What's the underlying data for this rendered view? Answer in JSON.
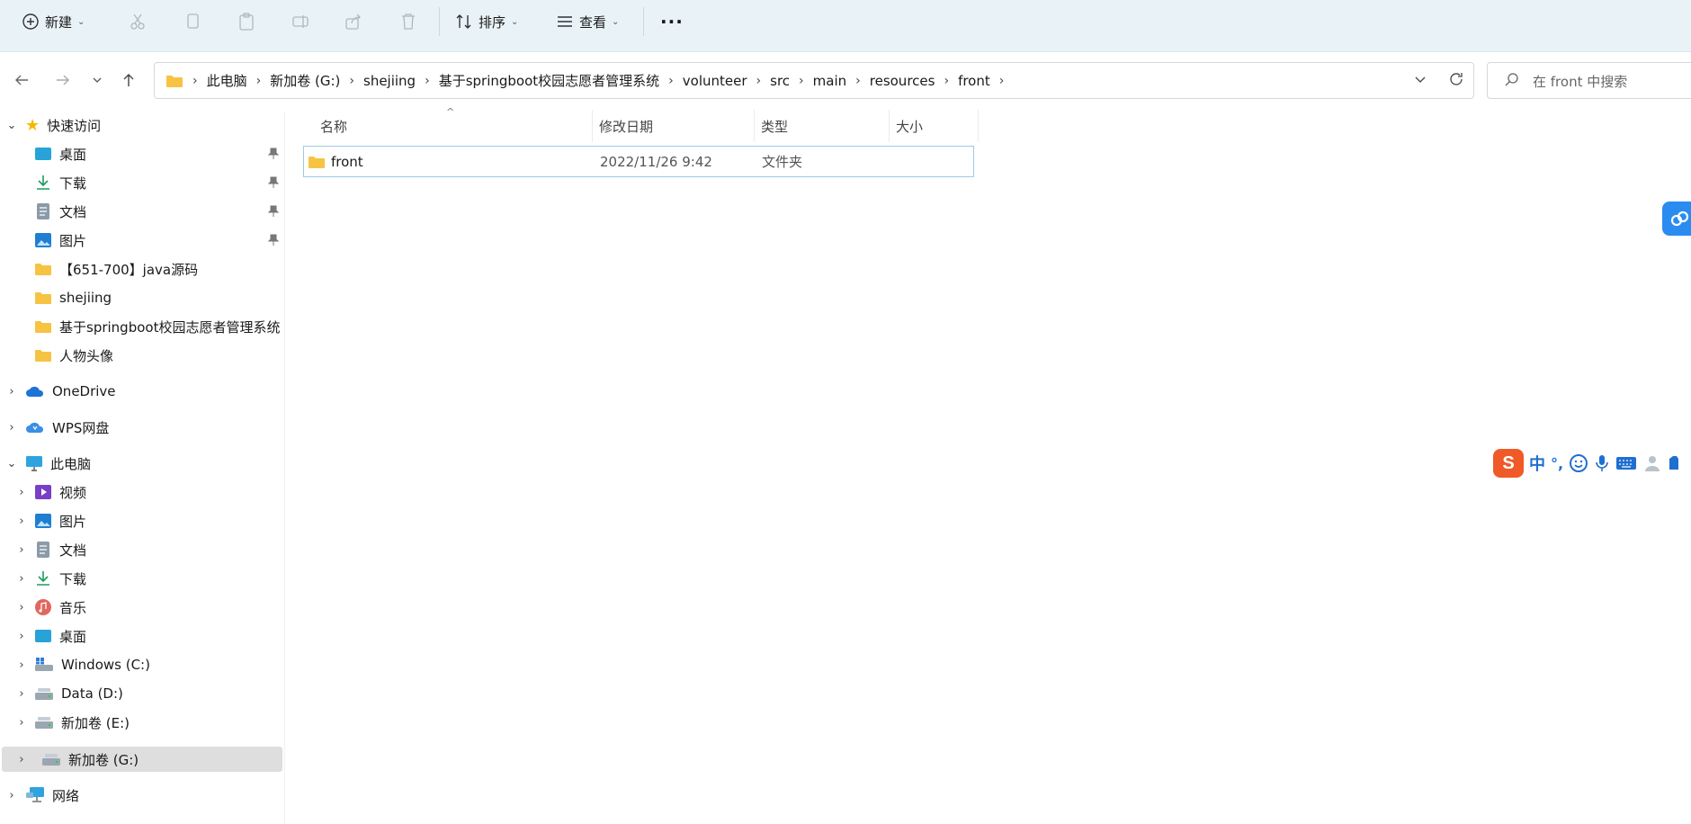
{
  "toolbar": {
    "new_label": "新建",
    "sort_label": "排序",
    "view_label": "查看",
    "more_label": "···"
  },
  "address": {
    "crumbs": [
      "此电脑",
      "新加卷 (G:)",
      "shejiing",
      "基于springboot校园志愿者管理系统",
      "volunteer",
      "src",
      "main",
      "resources",
      "front"
    ]
  },
  "search": {
    "placeholder": "在 front 中搜索"
  },
  "sidebar": {
    "quick_access": "快速访问",
    "quick_items": [
      "桌面",
      "下载",
      "文档",
      "图片",
      "【651-700】java源码",
      "shejiing",
      "基于springboot校园志愿者管理系统",
      "人物头像"
    ],
    "onedrive": "OneDrive",
    "wps": "WPS网盘",
    "this_pc": "此电脑",
    "pc_items": [
      "视频",
      "图片",
      "文档",
      "下载",
      "音乐",
      "桌面",
      "Windows (C:)",
      "Data (D:)",
      "新加卷 (E:)",
      "新加卷 (G:)"
    ],
    "network": "网络"
  },
  "columns": {
    "name": "名称",
    "modified": "修改日期",
    "type": "类型",
    "size": "大小"
  },
  "files": [
    {
      "name": "front",
      "modified": "2022/11/26 9:42",
      "type": "文件夹",
      "size": ""
    }
  ],
  "ime": {
    "lang": "中",
    "punct": "°,"
  },
  "colors": {
    "toolbar_bg": "#e9f3f7",
    "selection_border": "#9ec9e6",
    "folder": "#f6c342",
    "accent": "#2a8cf0",
    "ime_logo": "#f05a28"
  }
}
